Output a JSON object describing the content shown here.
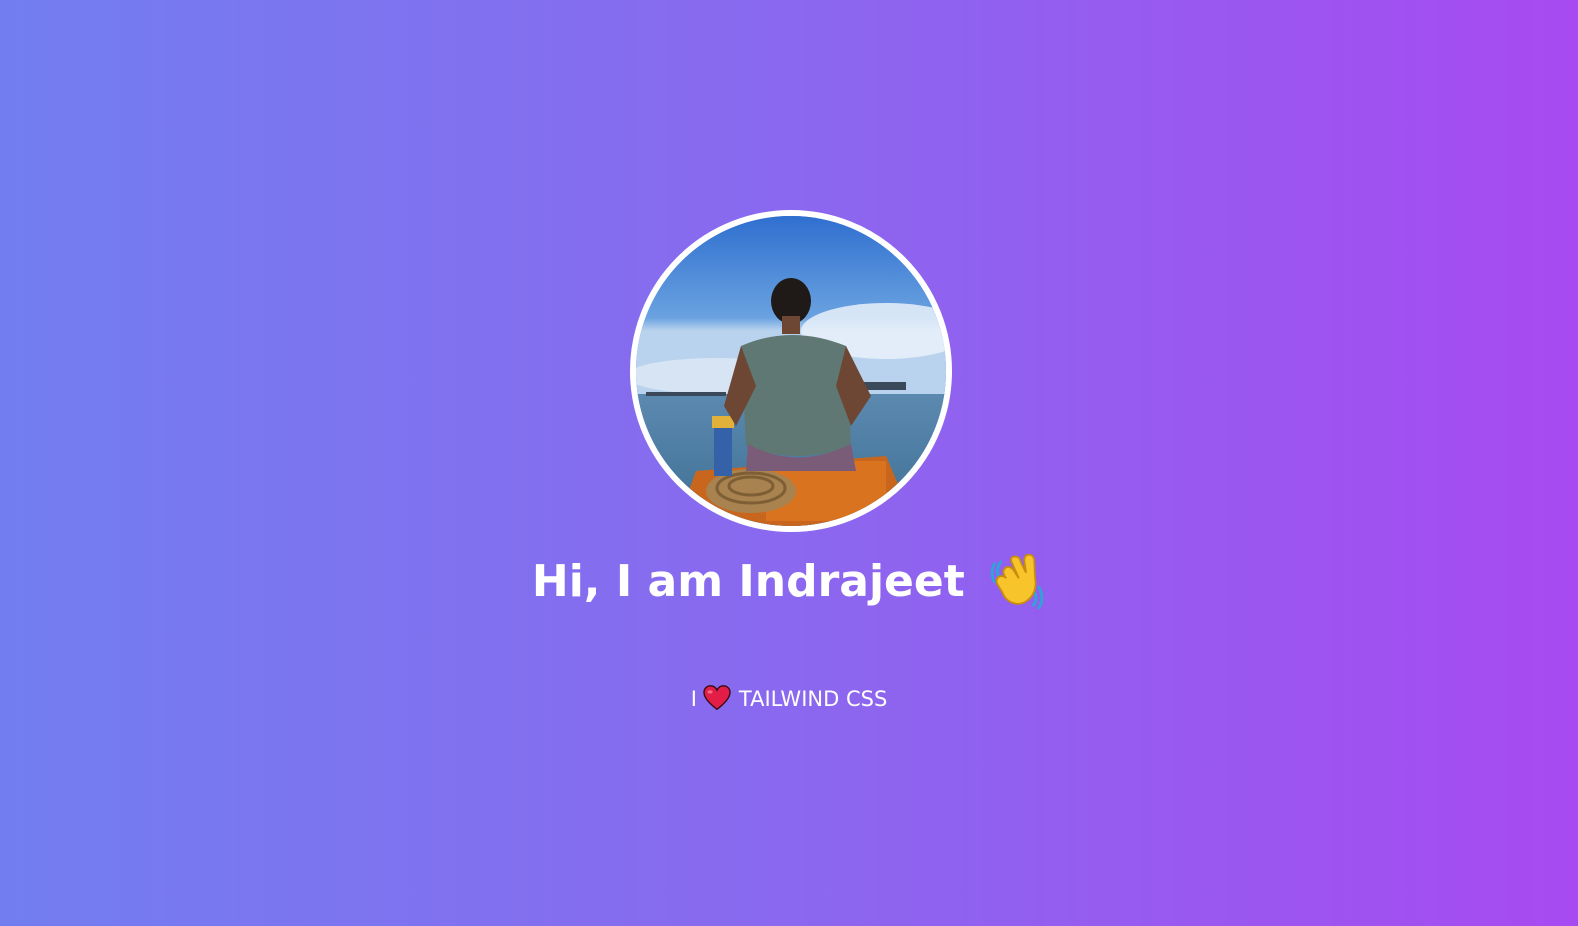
{
  "profile": {
    "greeting": "Hi, I am Indrajeet",
    "greeting_emoji": "waving-hand-icon",
    "tagline_prefix": "I",
    "tagline_emoji": "heart-icon",
    "tagline_suffix": "TAILWIND CSS"
  },
  "colors": {
    "gradient_start": "#727ef0",
    "gradient_end": "#a74af1",
    "text": "#ffffff",
    "heart": "#e11d48"
  }
}
